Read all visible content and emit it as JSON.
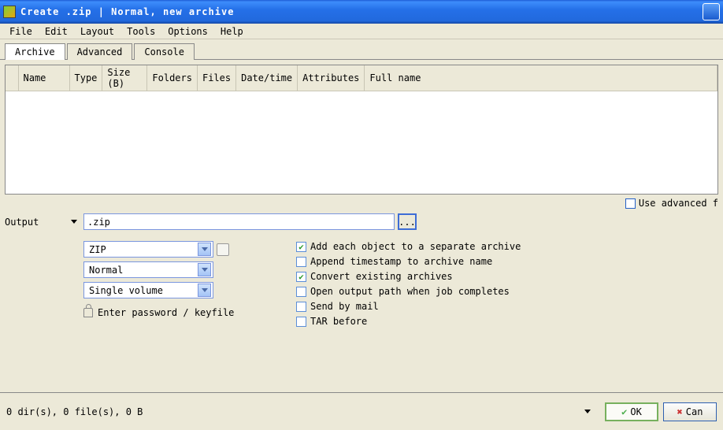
{
  "window": {
    "title": "Create .zip | Normal, new archive"
  },
  "menu": {
    "file": "File",
    "edit": "Edit",
    "layout": "Layout",
    "tools": "Tools",
    "options": "Options",
    "help": "Help"
  },
  "tabs": {
    "archive": "Archive",
    "advanced": "Advanced",
    "console": "Console"
  },
  "columns": {
    "name": "Name",
    "type": "Type",
    "size": "Size (B)",
    "folders": "Folders",
    "files": "Files",
    "datetime": "Date/time",
    "attributes": "Attributes",
    "fullname": "Full name"
  },
  "adv_filters_label": "Use advanced f",
  "output": {
    "label": "Output",
    "path": ".zip",
    "browse": "...",
    "format": "ZIP",
    "level": "Normal",
    "volume": "Single volume",
    "password_hint": "Enter password / keyfile"
  },
  "opts": {
    "separate": "Add each object to a separate archive",
    "timestamp": "Append timestamp to archive name",
    "convert": "Convert existing archives",
    "openpath": "Open output path when job completes",
    "sendmail": "Send by mail",
    "tarbefore": "TAR before"
  },
  "checked": {
    "separate": true,
    "timestamp": false,
    "convert": true,
    "openpath": false,
    "sendmail": false,
    "tarbefore": false,
    "adv_filters": false
  },
  "status": {
    "text": "0 dir(s), 0 file(s), 0 B",
    "ok": "OK",
    "cancel": "Can"
  }
}
